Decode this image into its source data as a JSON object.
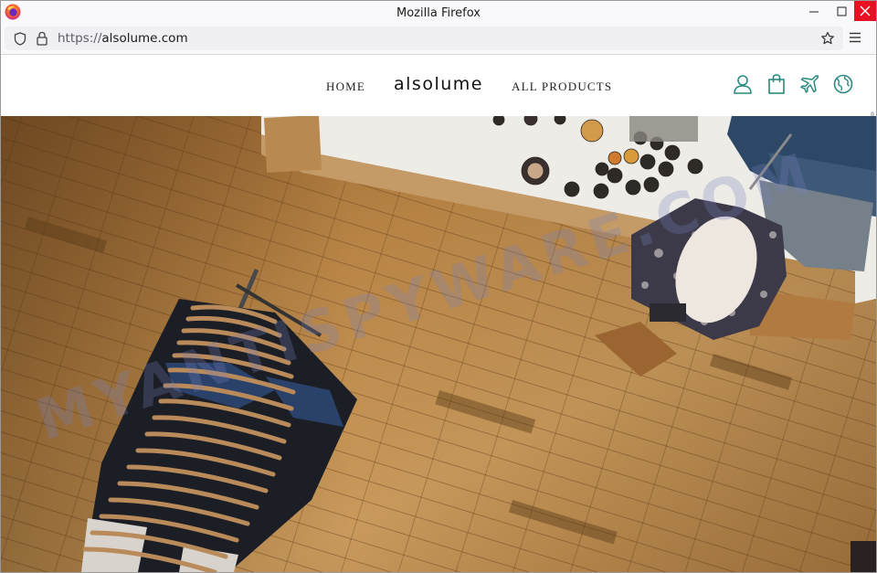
{
  "window": {
    "title": "Mozilla Firefox"
  },
  "addressbar": {
    "url_prefix": "https://",
    "url_host": "alsolume.com"
  },
  "site": {
    "brand": "alsolume",
    "nav": {
      "home": "HOME",
      "all_products": "ALL PRODUCTS"
    },
    "header_icons": [
      "user-icon",
      "shopping-bag-icon",
      "airplane-icon",
      "globe-icon"
    ],
    "accent_color": "#2a8a7f"
  },
  "hero": {
    "watermark": "MYANTISPYWARE.COM",
    "scene": "overhead photo of a clothing store with wooden floor and clothing rack"
  }
}
